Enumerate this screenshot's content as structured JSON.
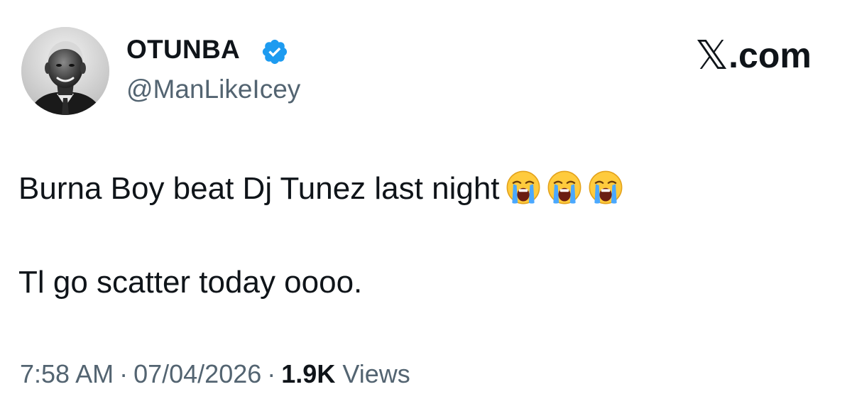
{
  "author": {
    "display_name": "OTUNBA",
    "handle": "@ManLikeIcey",
    "verified": true,
    "verified_color": "#1d9bf0",
    "avatar": "avatar-photo"
  },
  "brand": {
    "glyph": "𝕏",
    "suffix": ".com"
  },
  "tweet": {
    "line_1": "Burna Boy beat Dj Tunez last night",
    "line_1_emojis": [
      "loudly-crying-face",
      "loudly-crying-face",
      "loudly-crying-face"
    ],
    "line_2": "Tl go scatter today oooo."
  },
  "meta": {
    "time": "7:58 AM",
    "separator": "·",
    "date": "07/04/2026",
    "views_count": "1.9K",
    "views_label": "Views"
  },
  "colors": {
    "text_primary": "#0f1419",
    "text_secondary": "#536471"
  }
}
